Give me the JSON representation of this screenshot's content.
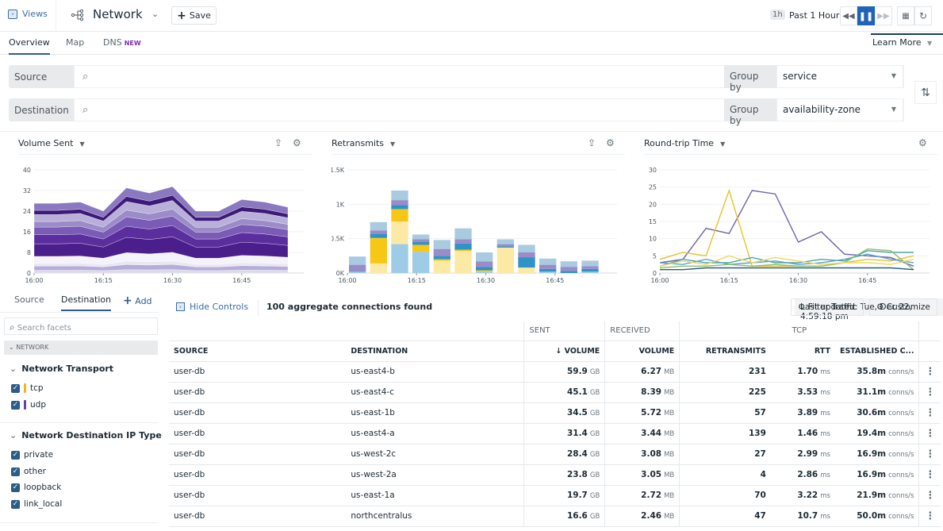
{
  "header": {
    "views_label": "Views",
    "title": "Network",
    "save_label": "Save",
    "time_badge": "1h",
    "time_label": "Past 1 Hour"
  },
  "tabs": [
    {
      "label": "Overview",
      "active": true
    },
    {
      "label": "Map"
    },
    {
      "label": "DNS",
      "badge": "NEW"
    }
  ],
  "learn_more": "Learn More",
  "filters": {
    "source_label": "Source",
    "destination_label": "Destination",
    "source_value": "",
    "destination_value": "",
    "group_by_label": "Group by",
    "source_group_by": "service",
    "destination_group_by": "availability-zone"
  },
  "chart_data": [
    {
      "type": "area",
      "title": "Volume Sent",
      "x": [
        "16:00",
        "16:05",
        "16:10",
        "16:15",
        "16:20",
        "16:25",
        "16:30",
        "16:35",
        "16:40",
        "16:45",
        "16:50",
        "16:55"
      ],
      "xticks": [
        "16:00",
        "16:15",
        "16:30",
        "16:45"
      ],
      "yticks": [
        "0",
        "8",
        "16",
        "24",
        "32",
        "40"
      ],
      "ylim": [
        0,
        40
      ],
      "stacked": true,
      "total": [
        27,
        27,
        27.5,
        24,
        33,
        31,
        33.5,
        24,
        24,
        28.5,
        27.5,
        25.5
      ],
      "colors": [
        "#dcd8ee",
        "#b5aed8",
        "#e9e7f4",
        "#f4f3fa",
        "#4a1f8c",
        "#5b2e9e",
        "#7a5bb6",
        "#9b8bc9",
        "#b9b0da",
        "#3d1a78",
        "#8a78c0"
      ]
    },
    {
      "type": "bar",
      "title": "Retransmits",
      "x": [
        "16:00",
        "16:05",
        "16:10",
        "16:15",
        "16:20",
        "16:25",
        "16:30",
        "16:35",
        "16:40",
        "16:45",
        "16:50",
        "16:55"
      ],
      "xticks": [
        "16:00",
        "16:15",
        "16:30",
        "16:45"
      ],
      "yticks": [
        "0K",
        "0.5K",
        "1K",
        "1.5K"
      ],
      "ylim": [
        0,
        1500
      ],
      "stacked": true,
      "series": [
        {
          "name": "light-blue",
          "color": "#9ecbe6",
          "values": [
            20,
            0,
            420,
            310,
            0,
            0,
            20,
            0,
            0,
            20,
            0,
            20
          ]
        },
        {
          "name": "pale-yellow",
          "color": "#fbe9a4",
          "values": [
            0,
            140,
            330,
            0,
            180,
            320,
            0,
            370,
            80,
            0,
            0,
            0
          ]
        },
        {
          "name": "yellow",
          "color": "#f7c715",
          "values": [
            0,
            370,
            180,
            100,
            20,
            20,
            20,
            0,
            0,
            0,
            0,
            0
          ]
        },
        {
          "name": "blue",
          "color": "#2e93c8",
          "values": [
            10,
            60,
            60,
            40,
            50,
            90,
            50,
            20,
            150,
            40,
            30,
            40
          ]
        },
        {
          "name": "purple",
          "color": "#9b8bc9",
          "values": [
            90,
            50,
            70,
            40,
            100,
            60,
            80,
            30,
            70,
            60,
            60,
            40
          ]
        },
        {
          "name": "top-blue",
          "color": "#a9cbe0",
          "values": [
            120,
            120,
            140,
            70,
            130,
            160,
            130,
            70,
            110,
            90,
            80,
            80
          ]
        }
      ]
    },
    {
      "type": "line",
      "title": "Round-trip Time",
      "x": [
        "16:00",
        "16:05",
        "16:10",
        "16:15",
        "16:20",
        "16:25",
        "16:30",
        "16:35",
        "16:40",
        "16:45",
        "16:50",
        "16:55"
      ],
      "xticks": [
        "16:00",
        "16:15",
        "16:30",
        "16:45"
      ],
      "yticks": [
        "0",
        "5",
        "10",
        "15",
        "20",
        "25",
        "30"
      ],
      "ylim": [
        0,
        30
      ],
      "series": [
        {
          "name": "purple",
          "color": "#6f63a8",
          "values": [
            3,
            4,
            13,
            11.5,
            24,
            23,
            9,
            12,
            5.5,
            5,
            4.5,
            2
          ]
        },
        {
          "name": "yellow",
          "color": "#e8c22c",
          "values": [
            4,
            6,
            5,
            24,
            2,
            2,
            2,
            2,
            3,
            4,
            3.5,
            5
          ]
        },
        {
          "name": "teal",
          "color": "#4aa6a6",
          "values": [
            2,
            4,
            3,
            3,
            4.5,
            3,
            3,
            4,
            3.5,
            6.5,
            6,
            6
          ]
        },
        {
          "name": "blue",
          "color": "#5da2d5",
          "values": [
            3,
            2.5,
            4,
            2.5,
            3,
            3.5,
            2.5,
            3,
            4,
            5.5,
            4,
            3
          ]
        },
        {
          "name": "green",
          "color": "#8dbf6a",
          "values": [
            1.5,
            2,
            2,
            2.5,
            2,
            2.5,
            2,
            2,
            3,
            7,
            6.5,
            1
          ]
        },
        {
          "name": "lightyellow",
          "color": "#f0d860",
          "values": [
            2,
            3.5,
            2.5,
            5,
            3,
            4.5,
            3.5,
            2.5,
            3,
            3,
            2.5,
            4
          ]
        },
        {
          "name": "navy",
          "color": "#2d5a8a",
          "values": [
            1,
            1,
            1.5,
            1.5,
            1.5,
            1.5,
            1.5,
            1.5,
            1.5,
            1.5,
            1.5,
            1
          ]
        }
      ]
    }
  ],
  "sidebar": {
    "tabs": [
      {
        "label": "Source"
      },
      {
        "label": "Destination",
        "active": true
      }
    ],
    "add_label": "Add",
    "search_placeholder": "Search facets",
    "section_label": "NETWORK",
    "groups": [
      {
        "title": "Network Transport",
        "items": [
          {
            "label": "tcp",
            "checked": true,
            "color": "#f2b51c"
          },
          {
            "label": "udp",
            "checked": true,
            "color": "#6a3fa0"
          }
        ]
      },
      {
        "title": "Network Destination IP Type",
        "items": [
          {
            "label": "private",
            "checked": true
          },
          {
            "label": "other",
            "checked": true
          },
          {
            "label": "loopback",
            "checked": true
          },
          {
            "label": "link_local",
            "checked": true
          }
        ]
      }
    ]
  },
  "main": {
    "hide_controls_label": "Hide Controls",
    "count_text": "100 aggregate connections found",
    "last_updated": "Last updated: Tue, Dec 22, 4:59:18 pm",
    "filter_traffic_label": "Filter Traffic",
    "customize_label": "Customize"
  },
  "table": {
    "group_headers": {
      "sent": "SENT",
      "received": "RECEIVED",
      "tcp": "TCP"
    },
    "columns": [
      "SOURCE",
      "DESTINATION",
      "↓ VOLUME",
      "VOLUME",
      "RETRANSMITS",
      "RTT",
      "ESTABLISHED C..."
    ],
    "rows": [
      {
        "source": "user-db",
        "destination": "us-east4-b",
        "sent": "59.9",
        "sent_unit": "GB",
        "recv": "6.27",
        "recv_unit": "MB",
        "retransmits": "231",
        "rtt": "1.70",
        "rtt_unit": "ms",
        "est": "35.8m",
        "est_unit": "conns/s"
      },
      {
        "source": "user-db",
        "destination": "us-east4-c",
        "sent": "45.1",
        "sent_unit": "GB",
        "recv": "8.39",
        "recv_unit": "MB",
        "retransmits": "225",
        "rtt": "3.53",
        "rtt_unit": "ms",
        "est": "31.1m",
        "est_unit": "conns/s"
      },
      {
        "source": "user-db",
        "destination": "us-east-1b",
        "sent": "34.5",
        "sent_unit": "GB",
        "recv": "5.72",
        "recv_unit": "MB",
        "retransmits": "57",
        "rtt": "3.89",
        "rtt_unit": "ms",
        "est": "30.6m",
        "est_unit": "conns/s"
      },
      {
        "source": "user-db",
        "destination": "us-east4-a",
        "sent": "31.4",
        "sent_unit": "GB",
        "recv": "3.44",
        "recv_unit": "MB",
        "retransmits": "139",
        "rtt": "1.46",
        "rtt_unit": "ms",
        "est": "19.4m",
        "est_unit": "conns/s"
      },
      {
        "source": "user-db",
        "destination": "us-west-2c",
        "sent": "28.4",
        "sent_unit": "GB",
        "recv": "3.08",
        "recv_unit": "MB",
        "retransmits": "27",
        "rtt": "2.99",
        "rtt_unit": "ms",
        "est": "16.9m",
        "est_unit": "conns/s"
      },
      {
        "source": "user-db",
        "destination": "us-west-2a",
        "sent": "23.8",
        "sent_unit": "GB",
        "recv": "3.05",
        "recv_unit": "MB",
        "retransmits": "4",
        "rtt": "2.86",
        "rtt_unit": "ms",
        "est": "16.9m",
        "est_unit": "conns/s"
      },
      {
        "source": "user-db",
        "destination": "us-east-1a",
        "sent": "19.7",
        "sent_unit": "GB",
        "recv": "2.72",
        "recv_unit": "MB",
        "retransmits": "70",
        "rtt": "3.22",
        "rtt_unit": "ms",
        "est": "21.9m",
        "est_unit": "conns/s"
      },
      {
        "source": "user-db",
        "destination": "northcentralus",
        "sent": "16.6",
        "sent_unit": "GB",
        "recv": "2.46",
        "recv_unit": "MB",
        "retransmits": "47",
        "rtt": "10.7",
        "rtt_unit": "ms",
        "est": "50.0m",
        "est_unit": "conns/s"
      }
    ]
  }
}
